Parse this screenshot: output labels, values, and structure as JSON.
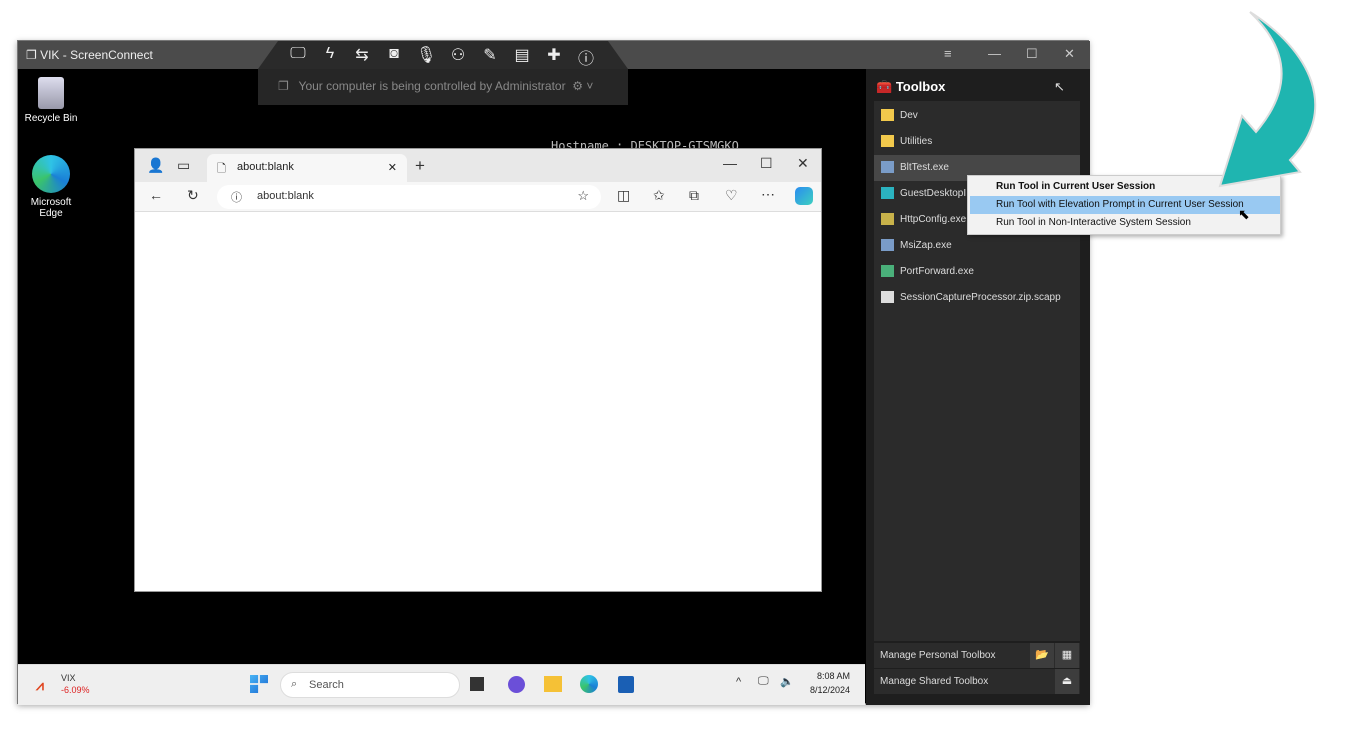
{
  "window": {
    "title": "VIK - ScreenConnect",
    "minimize": "—",
    "maximize": "☐",
    "close": "✕",
    "menu": "≡"
  },
  "control_toolbar": {
    "icons": [
      "monitor-icon",
      "lightning-icon",
      "swap-icon",
      "camera-icon",
      "microphone-icon",
      "users-icon",
      "pen-icon",
      "chat-icon",
      "plus-icon",
      "info-icon"
    ],
    "banner": "Your computer is being controlled by Administrator"
  },
  "desktop": {
    "icons": [
      {
        "label": "Recycle Bin"
      },
      {
        "label": "Microsoft Edge"
      }
    ],
    "hostname_text": "Hostname  :  DESKTOP-GTSMGKO"
  },
  "browser": {
    "tab_title": "about:blank",
    "url": "about:blank"
  },
  "taskbar": {
    "stock_name": "VIX",
    "stock_change": "-6.09%",
    "search_placeholder": "Search",
    "time": "8:08 AM",
    "date": "8/12/2024"
  },
  "toolbox": {
    "title": "Toolbox",
    "items": [
      {
        "label": "Dev",
        "icon": "folder-icon"
      },
      {
        "label": "Utilities",
        "icon": "folder-icon"
      },
      {
        "label": "BltTest.exe",
        "icon": "exe-icon"
      },
      {
        "label": "GuestDesktopI",
        "icon": "exe-icon"
      },
      {
        "label": "HttpConfig.exe",
        "icon": "exe-icon"
      },
      {
        "label": "MsiZap.exe",
        "icon": "exe-icon"
      },
      {
        "label": "PortForward.exe",
        "icon": "exe-icon"
      },
      {
        "label": "SessionCaptureProcessor.zip.scapp",
        "icon": "file-icon"
      }
    ],
    "selected": "BltTest.exe",
    "manage_personal": "Manage Personal Toolbox",
    "manage_shared": "Manage Shared Toolbox"
  },
  "context_menu": {
    "items": [
      "Run Tool in Current User Session",
      "Run Tool with Elevation Prompt in Current User Session",
      "Run Tool in Non-Interactive System Session"
    ],
    "highlighted": 1
  },
  "colors": {
    "arrow": "#1fb5b0",
    "highlight": "#99c9f2",
    "panel": "#1e1e1e"
  }
}
